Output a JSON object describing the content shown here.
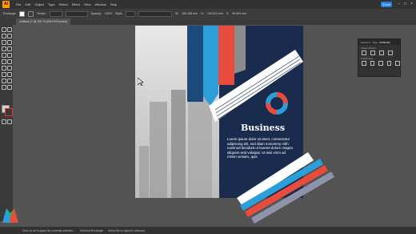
{
  "app": {
    "logo": "Ai",
    "share_label": "Share"
  },
  "menu": [
    "File",
    "Edit",
    "Object",
    "Type",
    "Select",
    "Effect",
    "View",
    "Window",
    "Help"
  ],
  "control_bar": {
    "selection_label": "Rectangle",
    "stroke_label": "Stroke:",
    "opacity_label": "Opacity:",
    "opacity_value": "100%",
    "style_label": "Style:",
    "w_label": "W:",
    "w_value": "180.188 mm",
    "h_label": "H:",
    "h_value": "140.513 mm",
    "x_label": "X:",
    "x_value": "90.094 mm"
  },
  "document_tab": {
    "label": "Untitled-1* @ 100 % (CMYK/Preview)"
  },
  "panel": {
    "tabs": [
      "Transform",
      "Align",
      "Pathfinder"
    ],
    "active_tab": "Pathfinder",
    "shape_modes_label": "Shape Modes:",
    "pathfinders_label": "Pathfinders:"
  },
  "artwork": {
    "heading": "Business",
    "body": "Lorem ipsum dolor sit amet, consectetur adipiscing elit, sed diam nonummy nibh euismod tincidunt ut laoreet dolore magna aliquam erat volutpat. Ut wisi enim ad minim veniam, quis",
    "colors": {
      "navy": "#1a2c4e",
      "blue": "#2c9fd9",
      "dark_blue": "#1c4a7a",
      "red": "#e74c3c",
      "grey": "#8d93a8"
    }
  },
  "status": {
    "hint": "Click on art to apply the currently selected...",
    "mid": "Selected Rectangle",
    "right": "Select file to object in Artboard"
  },
  "icons": [
    "ai-logo-icon",
    "search-icon",
    "minimize-icon",
    "maximize-icon",
    "close-icon",
    "selection-tool-icon",
    "pen-tool-icon",
    "type-tool-icon",
    "shape-tool-icon",
    "hand-tool-icon",
    "zoom-tool-icon",
    "fill-swatch-icon",
    "stroke-swatch-icon",
    "donut-logo-icon",
    "watermark-logo-icon"
  ]
}
